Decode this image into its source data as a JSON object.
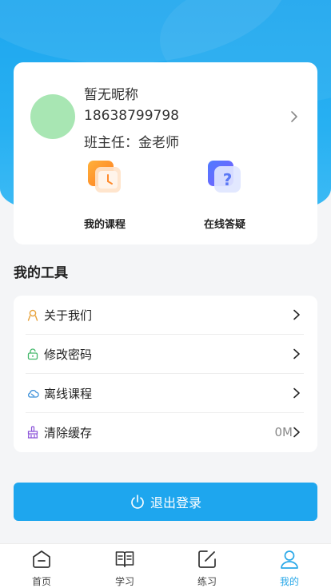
{
  "profile": {
    "nickname": "暂无昵称",
    "phone": "18638799798",
    "teacher": "班主任：金老师"
  },
  "quick_actions": {
    "course_label": "我的课程",
    "answer_label": "在线答疑"
  },
  "tools": {
    "title": "我的工具",
    "items": [
      {
        "label": "关于我们",
        "icon": "user-badge-icon",
        "color": "#e7a23b"
      },
      {
        "label": "修改密码",
        "icon": "lock-icon",
        "color": "#43b86a"
      },
      {
        "label": "离线课程",
        "icon": "cloud-icon",
        "color": "#3b8fd9"
      },
      {
        "label": "清除缓存",
        "icon": "broom-icon",
        "color": "#8a52d8",
        "value": "0M"
      }
    ]
  },
  "logout": {
    "label": "退出登录"
  },
  "tabbar": {
    "tabs": [
      {
        "label": "首页",
        "icon": "home-icon"
      },
      {
        "label": "学习",
        "icon": "book-icon"
      },
      {
        "label": "练习",
        "icon": "edit-icon"
      },
      {
        "label": "我的",
        "icon": "user-icon",
        "active": true
      }
    ]
  },
  "colors": {
    "accent": "#1ea6ee",
    "avatar": "#a8e6b3",
    "active_tab": "#29a8e8"
  }
}
